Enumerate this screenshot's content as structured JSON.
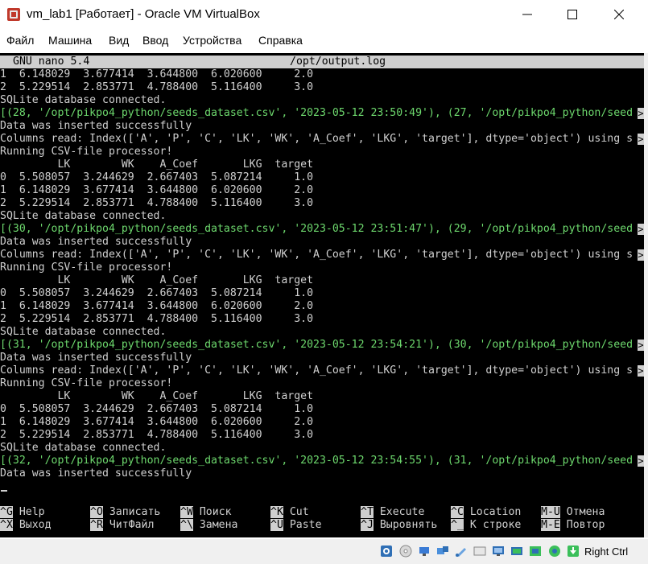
{
  "window": {
    "title": "vm_lab1 [Работает] - Oracle VM VirtualBox"
  },
  "menu": [
    "Файл",
    "Машина",
    "Вид",
    "Ввод",
    "Устройства",
    "Справка"
  ],
  "nano": {
    "version": "GNU nano 5.4",
    "filename": "/opt/output.log"
  },
  "terminal_lines": [
    {
      "text": "1  6.148029  3.677414  3.644800  6.020600     2.0",
      "color": "default",
      "truncated": false
    },
    {
      "text": "2  5.229514  2.853771  4.788400  5.116400     3.0",
      "color": "default",
      "truncated": false
    },
    {
      "text": "SQLite database connected.",
      "color": "default",
      "truncated": false
    },
    {
      "text": "[(28, '/opt/pikpo4_python/seeds_dataset.csv', '2023-05-12 23:50:49'), (27, '/opt/pikpo4_python/seed",
      "color": "green",
      "truncated": true
    },
    {
      "text": "Data was inserted successfully",
      "color": "default",
      "truncated": false
    },
    {
      "text": "Columns read: Index(['A', 'P', 'C', 'LK', 'WK', 'A_Coef', 'LKG', 'target'], dtype='object') using s",
      "color": "default",
      "truncated": true
    },
    {
      "text": "Running CSV-file processor!",
      "color": "default",
      "truncated": false
    },
    {
      "text": "         LK        WK    A_Coef       LKG  target",
      "color": "default",
      "truncated": false
    },
    {
      "text": "0  5.508057  3.244629  2.667403  5.087214     1.0",
      "color": "default",
      "truncated": false
    },
    {
      "text": "1  6.148029  3.677414  3.644800  6.020600     2.0",
      "color": "default",
      "truncated": false
    },
    {
      "text": "2  5.229514  2.853771  4.788400  5.116400     3.0",
      "color": "default",
      "truncated": false
    },
    {
      "text": "SQLite database connected.",
      "color": "default",
      "truncated": false
    },
    {
      "text": "[(30, '/opt/pikpo4_python/seeds_dataset.csv', '2023-05-12 23:51:47'), (29, '/opt/pikpo4_python/seed",
      "color": "green",
      "truncated": true
    },
    {
      "text": "Data was inserted successfully",
      "color": "default",
      "truncated": false
    },
    {
      "text": "Columns read: Index(['A', 'P', 'C', 'LK', 'WK', 'A_Coef', 'LKG', 'target'], dtype='object') using s",
      "color": "default",
      "truncated": true
    },
    {
      "text": "Running CSV-file processor!",
      "color": "default",
      "truncated": false
    },
    {
      "text": "         LK        WK    A_Coef       LKG  target",
      "color": "default",
      "truncated": false
    },
    {
      "text": "0  5.508057  3.244629  2.667403  5.087214     1.0",
      "color": "default",
      "truncated": false
    },
    {
      "text": "1  6.148029  3.677414  3.644800  6.020600     2.0",
      "color": "default",
      "truncated": false
    },
    {
      "text": "2  5.229514  2.853771  4.788400  5.116400     3.0",
      "color": "default",
      "truncated": false
    },
    {
      "text": "SQLite database connected.",
      "color": "default",
      "truncated": false
    },
    {
      "text": "[(31, '/opt/pikpo4_python/seeds_dataset.csv', '2023-05-12 23:54:21'), (30, '/opt/pikpo4_python/seed",
      "color": "green",
      "truncated": true
    },
    {
      "text": "Data was inserted successfully",
      "color": "default",
      "truncated": false
    },
    {
      "text": "Columns read: Index(['A', 'P', 'C', 'LK', 'WK', 'A_Coef', 'LKG', 'target'], dtype='object') using s",
      "color": "default",
      "truncated": true
    },
    {
      "text": "Running CSV-file processor!",
      "color": "default",
      "truncated": false
    },
    {
      "text": "         LK        WK    A_Coef       LKG  target",
      "color": "default",
      "truncated": false
    },
    {
      "text": "0  5.508057  3.244629  2.667403  5.087214     1.0",
      "color": "default",
      "truncated": false
    },
    {
      "text": "1  6.148029  3.677414  3.644800  6.020600     2.0",
      "color": "default",
      "truncated": false
    },
    {
      "text": "2  5.229514  2.853771  4.788400  5.116400     3.0",
      "color": "default",
      "truncated": false
    },
    {
      "text": "SQLite database connected.",
      "color": "default",
      "truncated": false
    },
    {
      "text": "[(32, '/opt/pikpo4_python/seeds_dataset.csv', '2023-05-12 23:54:55'), (31, '/opt/pikpo4_python/seed",
      "color": "green",
      "truncated": true
    },
    {
      "text": "Data was inserted successfully",
      "color": "default",
      "truncated": false
    }
  ],
  "shortcuts": [
    {
      "key": "^G",
      "label": "Help"
    },
    {
      "key": "^X",
      "label": "Выход"
    },
    {
      "key": "^O",
      "label": "Записать"
    },
    {
      "key": "^R",
      "label": "ЧитФайл"
    },
    {
      "key": "^W",
      "label": "Поиск"
    },
    {
      "key": "^\\",
      "label": "Замена"
    },
    {
      "key": "^K",
      "label": "Cut"
    },
    {
      "key": "^U",
      "label": "Paste"
    },
    {
      "key": "^T",
      "label": "Execute"
    },
    {
      "key": "^J",
      "label": "Выровнять"
    },
    {
      "key": "^C",
      "label": "Location"
    },
    {
      "key": "^_",
      "label": "К строке"
    },
    {
      "key": "M-U",
      "label": "Отмена"
    },
    {
      "key": "M-E",
      "label": "Повтор"
    }
  ],
  "status": {
    "host_key": "Right Ctrl",
    "icons": [
      "cpu-icon",
      "optical-drive-icon",
      "network-icon",
      "usb-icon",
      "shared-folder-icon",
      "display-icon",
      "monitor-icon",
      "video-capture-icon",
      "vm-state-icon",
      "mouse-integration-icon",
      "arrow-down-icon"
    ]
  },
  "colors": {
    "terminal_bg": "#000000",
    "terminal_fg": "#d0d0d0",
    "terminal_green": "#6dd86d",
    "nano_bar": "#cfcfcf"
  }
}
